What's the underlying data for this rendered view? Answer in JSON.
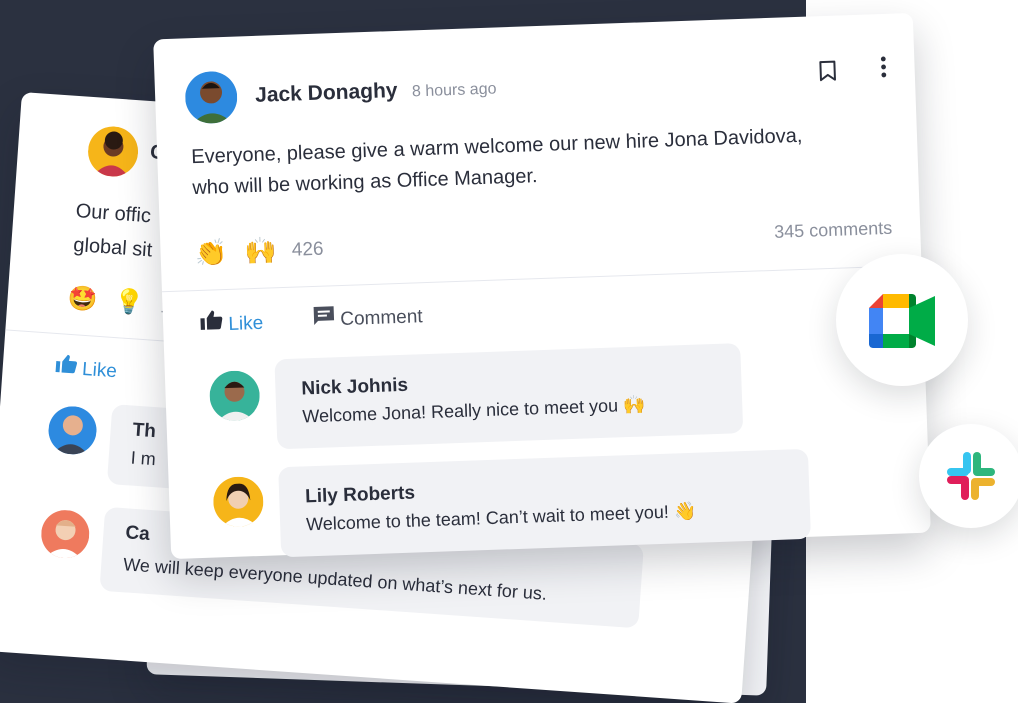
{
  "front_post": {
    "author": "Jack Donaghy",
    "time": "8 hours ago",
    "body_line1": "Everyone, please give a warm welcome our new hire Jona Davidova,",
    "body_line2": "who will be working as Office Manager.",
    "reaction_count": "426",
    "comments_count": "345 comments",
    "like_label": "Like",
    "comment_label": "Comment",
    "comments": [
      {
        "name": "Nick Johnis",
        "text": "Welcome Jona! Really nice to meet you 🙌"
      },
      {
        "name": "Lily Roberts",
        "text": "Welcome to the team! Can’t wait to meet you! 👋"
      }
    ]
  },
  "back_post": {
    "author_fragment": "C",
    "body_line1": "Our offic",
    "body_line2": "global sit",
    "reaction_fragment": "1",
    "like_label": "Like",
    "comments": [
      {
        "name": "Th",
        "text": "I m"
      },
      {
        "name": "Ca",
        "text": "We will keep everyone updated on what’s next for us."
      }
    ]
  },
  "apps": [
    "google-meet",
    "slack"
  ],
  "colors": {
    "dark_bg": "#2b3140",
    "accent": "#2f8fd8",
    "meet_blue": "#4285f4",
    "meet_green": "#00ac47",
    "meet_yellow": "#ffba00",
    "meet_red": "#ea4335"
  }
}
